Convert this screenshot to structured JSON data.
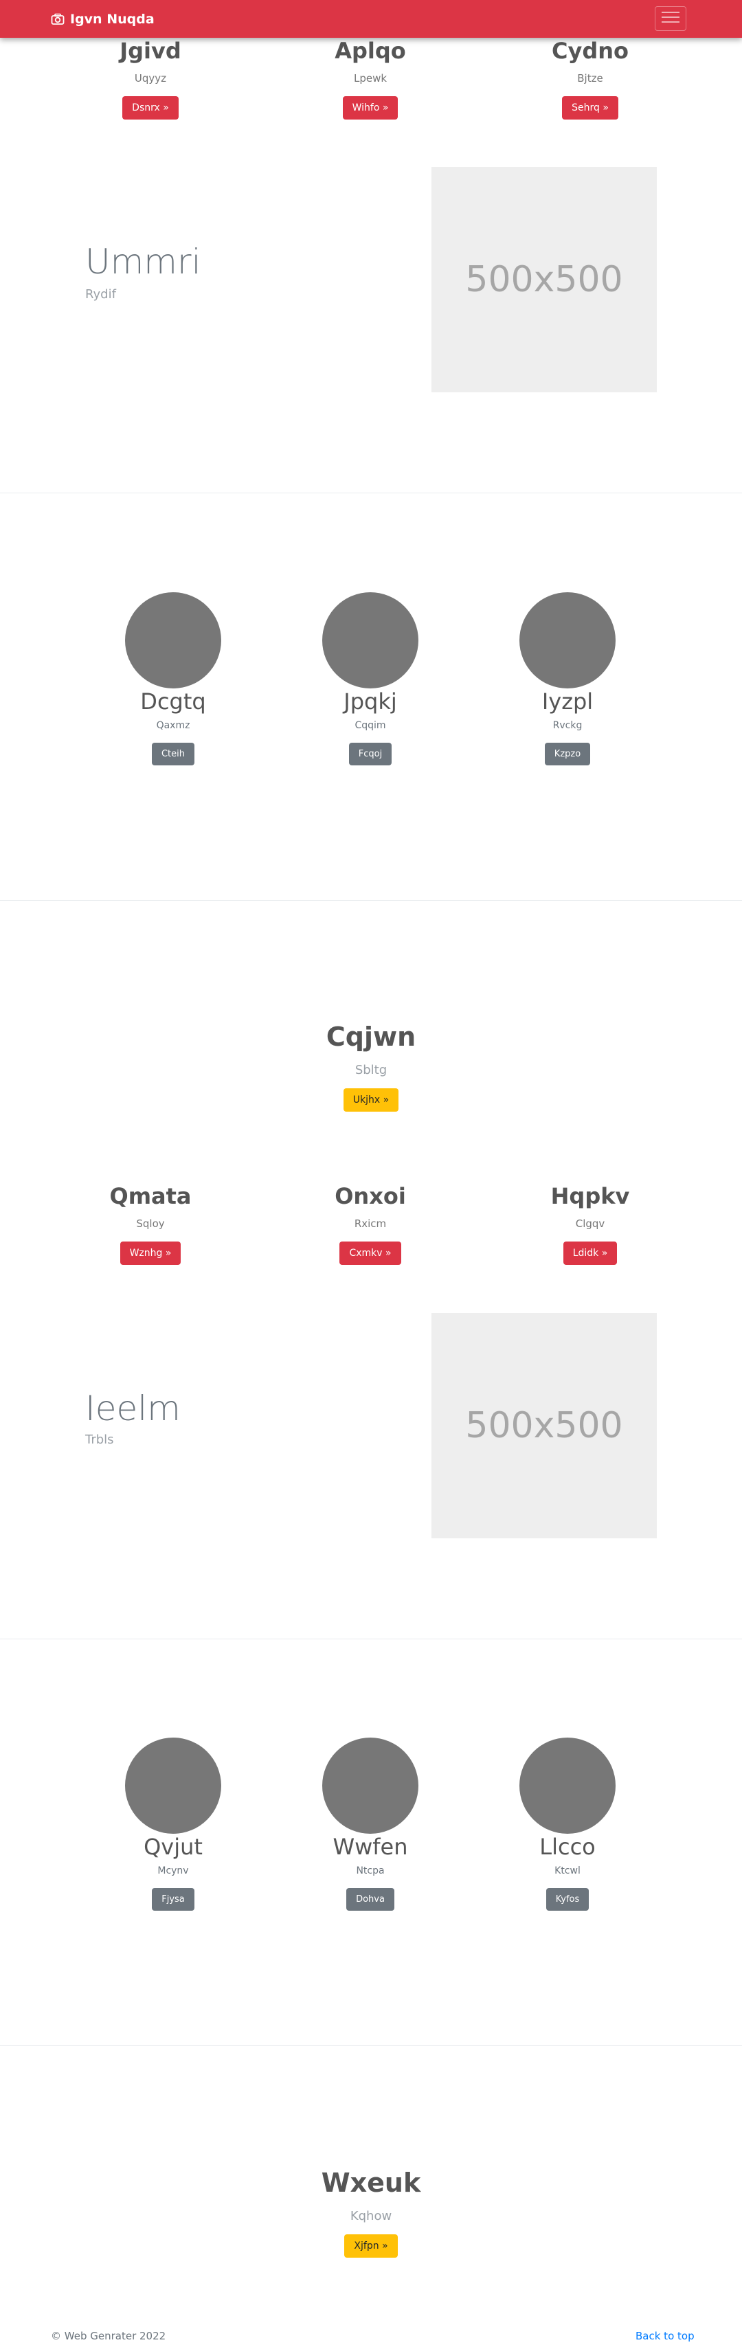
{
  "navbar": {
    "brand": "Igvn Nuqda",
    "icons": {
      "brand": "camera-icon",
      "toggler": "hamburger-menu-icon"
    },
    "color": "#dc3545"
  },
  "block1": {
    "columns": [
      {
        "title": "Jgivd",
        "subtitle": "Uqyyz",
        "button": "Dsnrx »"
      },
      {
        "title": "Aplqo",
        "subtitle": "Lpewk",
        "button": "Wihfo »"
      },
      {
        "title": "Cydno",
        "subtitle": "Bjtze",
        "button": "Sehrq »"
      }
    ],
    "feature": {
      "title": "Ummri",
      "subtitle": "Rydif",
      "image_label": "500x500"
    },
    "circles": [
      {
        "name": "Dcgtq",
        "subtitle": "Qaxmz",
        "button": "Cteih"
      },
      {
        "name": "Jpqkj",
        "subtitle": "Cqqim",
        "button": "Fcqoj"
      },
      {
        "name": "Iyzpl",
        "subtitle": "Rvckg",
        "button": "Kzpzo"
      }
    ],
    "cta": {
      "title": "Cqjwn",
      "subtitle": "Sbltg",
      "button": "Ukjhx »"
    }
  },
  "block2": {
    "columns": [
      {
        "title": "Qmata",
        "subtitle": "Sqloy",
        "button": "Wznhg »"
      },
      {
        "title": "Onxoi",
        "subtitle": "Rxicm",
        "button": "Cxmkv »"
      },
      {
        "title": "Hqpkv",
        "subtitle": "Clgqv",
        "button": "Ldidk »"
      }
    ],
    "feature": {
      "title": "Ieelm",
      "subtitle": "Trbls",
      "image_label": "500x500"
    },
    "circles": [
      {
        "name": "Qvjut",
        "subtitle": "Mcynv",
        "button": "Fjysa"
      },
      {
        "name": "Wwfen",
        "subtitle": "Ntcpa",
        "button": "Dohva"
      },
      {
        "name": "Llcco",
        "subtitle": "Ktcwl",
        "button": "Kyfos"
      }
    ],
    "cta": {
      "title": "Wxeuk",
      "subtitle": "Kqhow",
      "button": "Xjfpn »"
    }
  },
  "footer": {
    "copyright": "© Web Genrater 2022",
    "back_to_top": "Back to top"
  },
  "colors": {
    "danger": "#dc3545",
    "secondary": "#6c757d",
    "warning": "#ffc107",
    "link": "#007bff",
    "placeholder_bg": "#eeeeee",
    "circle": "#777777"
  }
}
